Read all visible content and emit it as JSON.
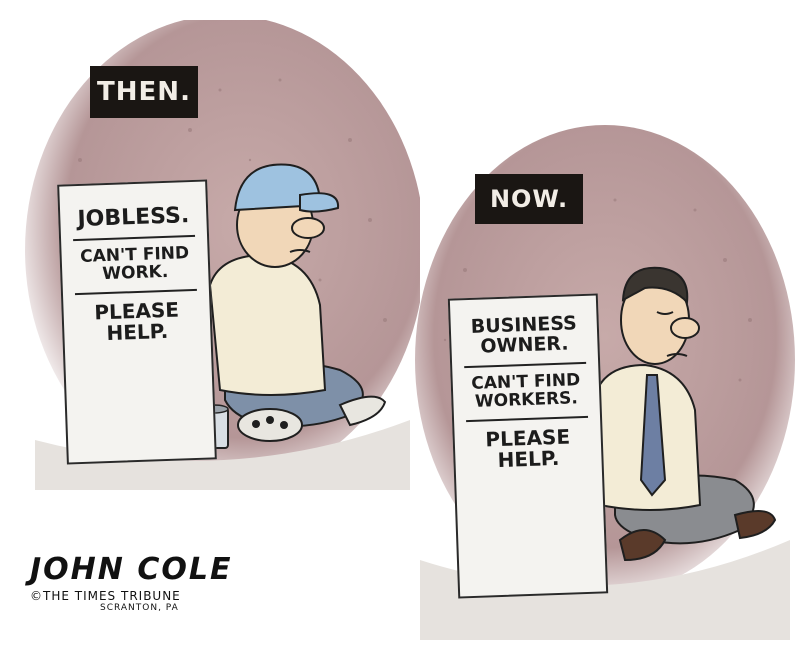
{
  "panels": {
    "then": {
      "label": "THEN.",
      "sign": {
        "line1": "JOBLESS.",
        "line2": "CAN'T FIND",
        "line3": "WORK.",
        "line4": "PLEASE",
        "line5": "HELP."
      }
    },
    "now": {
      "label": "NOW.",
      "sign": {
        "line1": "BUSINESS",
        "line2": "OWNER.",
        "line3": "CAN'T FIND",
        "line4": "WORKERS.",
        "line5": "PLEASE",
        "line6": "HELP."
      }
    }
  },
  "signature": {
    "name": "JOHN COLE",
    "outlet": "©THE TIMES TRIBUNE",
    "place": "SCRANTON, PA"
  },
  "colors": {
    "wall": "#b89a9a",
    "ground": "#e6e2de",
    "cap": "#9ec2e0",
    "jeans": "#7e90a8",
    "tie": "#6d7fa3",
    "trousers": "#8a8c90",
    "skin": "#f1d7b8",
    "sweater": "#f3ecd6"
  }
}
